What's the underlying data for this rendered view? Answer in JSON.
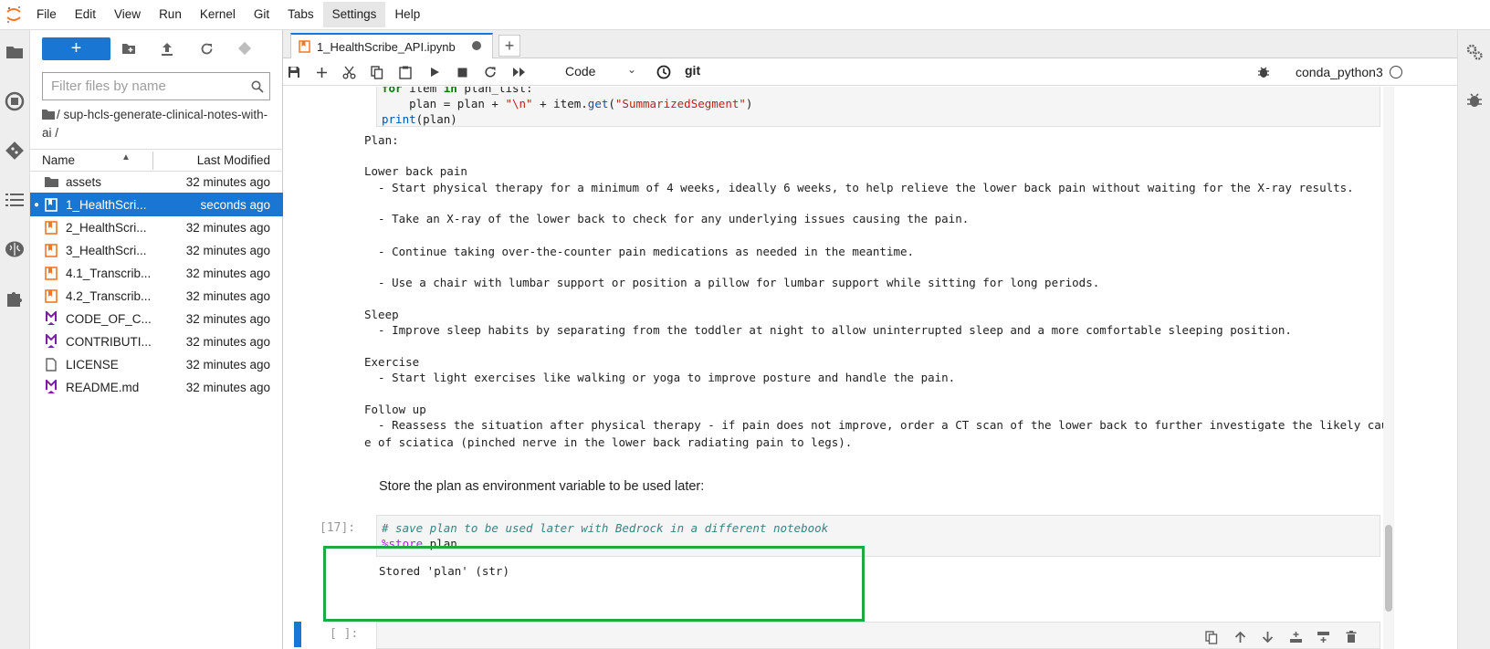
{
  "menu": {
    "items": [
      "File",
      "Edit",
      "View",
      "Run",
      "Kernel",
      "Git",
      "Tabs",
      "Settings",
      "Help"
    ]
  },
  "filebrowser": {
    "new_label": "+",
    "filter_placeholder": "Filter files by name",
    "breadcrumb": "/ sup-hcls-generate-clinical-notes-with-ai /",
    "col_name": "Name",
    "col_modified": "Last Modified",
    "files": [
      {
        "name": "assets",
        "modified": "32 minutes ago",
        "type": "folder"
      },
      {
        "name": "1_HealthScri...",
        "modified": "seconds ago",
        "type": "notebook",
        "selected": true
      },
      {
        "name": "2_HealthScri...",
        "modified": "32 minutes ago",
        "type": "notebook"
      },
      {
        "name": "3_HealthScri...",
        "modified": "32 minutes ago",
        "type": "notebook"
      },
      {
        "name": "4.1_Transcrib...",
        "modified": "32 minutes ago",
        "type": "notebook"
      },
      {
        "name": "4.2_Transcrib...",
        "modified": "32 minutes ago",
        "type": "notebook"
      },
      {
        "name": "CODE_OF_C...",
        "modified": "32 minutes ago",
        "type": "markdown"
      },
      {
        "name": "CONTRIBUTI...",
        "modified": "32 minutes ago",
        "type": "markdown"
      },
      {
        "name": "LICENSE",
        "modified": "32 minutes ago",
        "type": "file"
      },
      {
        "name": "README.md",
        "modified": "32 minutes ago",
        "type": "markdown"
      }
    ]
  },
  "tab": {
    "title": "1_HealthScribe_API.ipynb",
    "add_label": "+"
  },
  "toolbar": {
    "cell_type": "Code",
    "git_label": "git",
    "kernel_name": "conda_python3"
  },
  "cell_code_prev": {
    "line1": "for item in plan_list:",
    "line2_a": "    plan = plan + ",
    "line2_str1": "\"\\n\"",
    "line2_b": " + item.",
    "line2_fn": "get",
    "line2_c": "(",
    "line2_str2": "\"SummarizedSegment\"",
    "line2_d": ")",
    "line3": "print(plan)"
  },
  "output_lines": [
    "Plan:",
    "",
    "Lower back pain",
    "  - Start physical therapy for a minimum of 4 weeks, ideally 6 weeks, to help relieve the lower back pain without waiting for the X-ray results.",
    "",
    "  - Take an X-ray of the lower back to check for any underlying issues causing the pain.",
    "",
    "  - Continue taking over-the-counter pain medications as needed in the meantime.",
    "",
    "  - Use a chair with lumbar support or position a pillow for lumbar support while sitting for long periods.",
    "",
    "Sleep",
    "  - Improve sleep habits by separating from the toddler at night to allow uninterrupted sleep and a more comfortable sleeping position.",
    "",
    "Exercise",
    "  - Start light exercises like walking or yoga to improve posture and handle the pain.",
    "",
    "Follow up",
    "  - Reassess the situation after physical therapy - if pain does not improve, order a CT scan of the lower back to further investigate the likely caus",
    "e of sciatica (pinched nerve in the lower back radiating pain to legs)."
  ],
  "markdown_text": "Store the plan as environment variable to be used later:",
  "cell17": {
    "prompt": "[17]:",
    "comment": "# save plan to be used later with Bedrock in a different notebook",
    "magic": "%store",
    "magic_arg": " plan",
    "output": "Stored 'plan' (str)"
  },
  "empty_cell": {
    "prompt": "[ ]:"
  },
  "colors": {
    "accent": "#1976d2",
    "highlight_box": "#1fa847"
  }
}
